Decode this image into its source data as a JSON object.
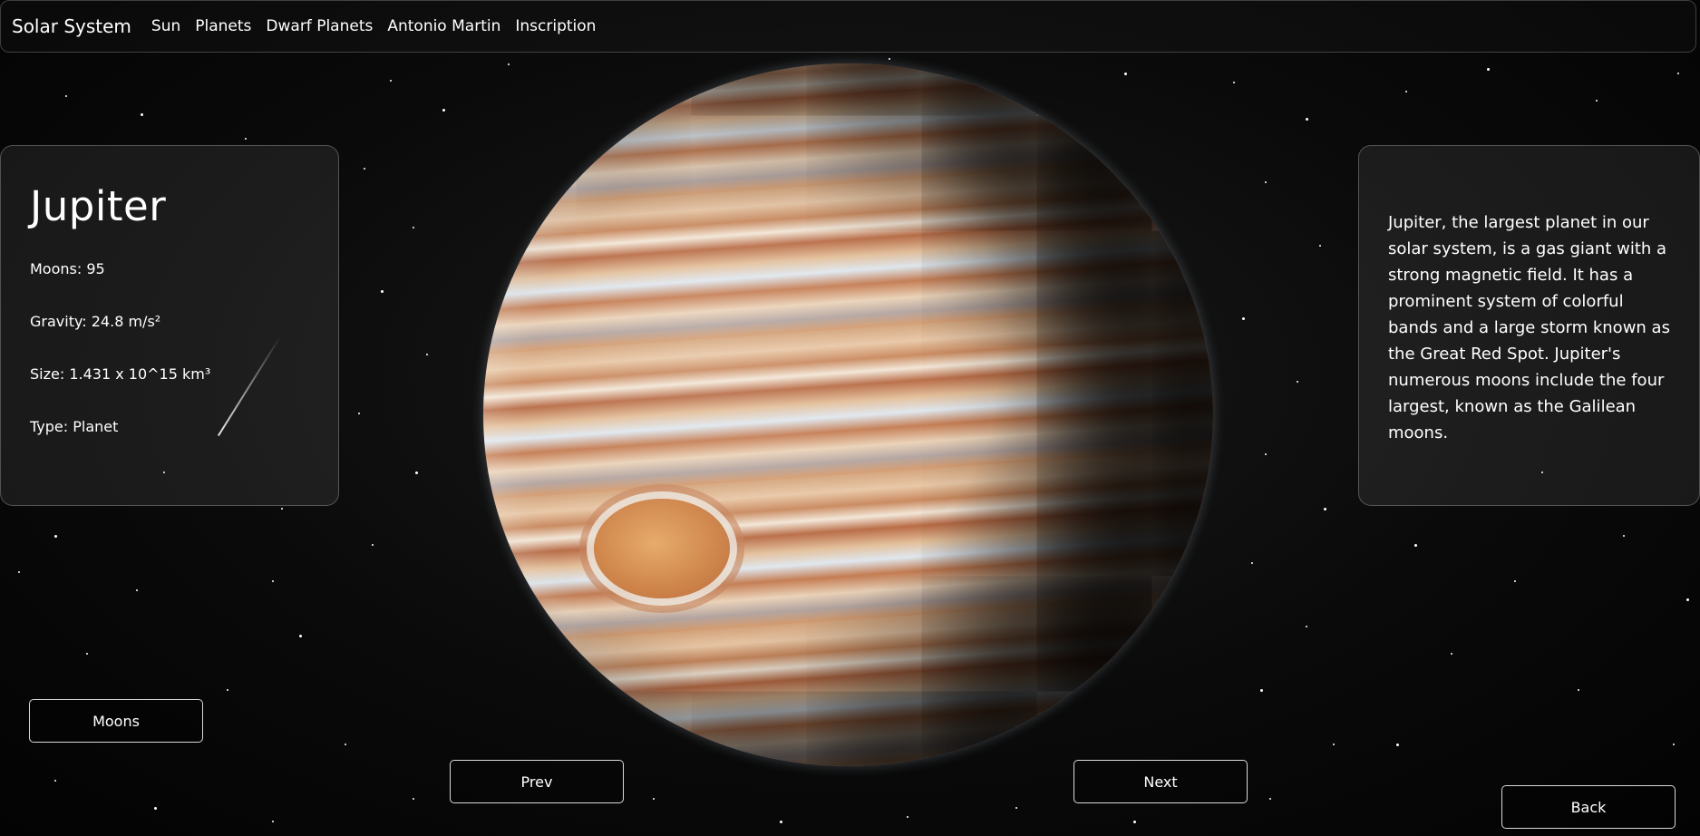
{
  "nav": {
    "brand": "Solar System",
    "links": [
      "Sun",
      "Planets",
      "Dwarf Planets",
      "Antonio Martin",
      "Inscription"
    ]
  },
  "planet": {
    "name": "Jupiter",
    "stats": {
      "moons": "Moons: 95",
      "gravity": "Gravity: 24.8 m/s²",
      "size": "Size: 1.431 x 10^15 km³",
      "type": "Type: Planet"
    },
    "description": "Jupiter, the largest planet in our solar system, is a gas giant with a strong magnetic field. It has a prominent system of colorful bands and a large storm known as the Great Red Spot. Jupiter's numerous moons include the four largest, known as the Galilean moons."
  },
  "buttons": {
    "moons": "Moons",
    "prev": "Prev",
    "next": "Next",
    "back": "Back"
  },
  "colors": {
    "background": "#050505",
    "text": "#ffffff",
    "panel_border": "rgba(255,255,255,0.25)"
  }
}
